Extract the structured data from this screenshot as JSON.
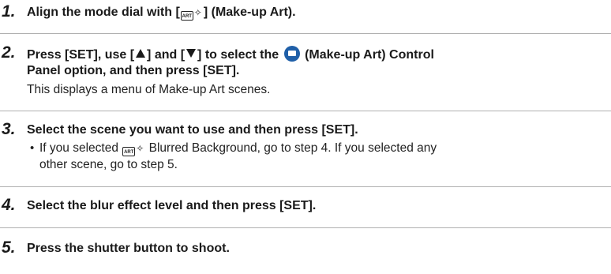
{
  "steps": [
    {
      "number": "1.",
      "before_icon": "Align the mode dial with [",
      "after_icon": "] (Make-up Art)."
    },
    {
      "number": "2.",
      "seg1": "Press [SET], use [",
      "seg2": "] and [",
      "seg3": "] to select the",
      "seg4": "(Make-up Art) Control",
      "line2": "Panel option, and then press [SET].",
      "description": "This displays a menu of Make-up Art scenes."
    },
    {
      "number": "3.",
      "title": "Select the scene you want to use and then press [SET].",
      "bullet_line1_after_icon": "Blurred Background, go to step 4. If you selected any",
      "bullet_prefix": "If you selected",
      "bullet_line2": "other scene, go to step 5."
    },
    {
      "number": "4.",
      "title": "Select the blur effect level and then press [SET]."
    },
    {
      "number": "5.",
      "title": "Press the shutter button to shoot."
    }
  ],
  "icons": {
    "art_icon_text": "ART",
    "sparkle": "✧",
    "panel_color": "#1f5fa8"
  }
}
